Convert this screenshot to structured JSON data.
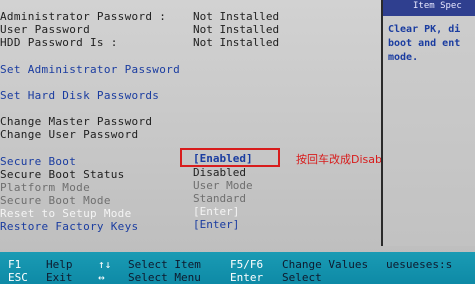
{
  "help_pane": {
    "title": "Item Spec",
    "lines": [
      "Clear PK, di",
      "boot and ent",
      "mode."
    ]
  },
  "passwords": [
    {
      "label": "Administrator Password :",
      "value": "Not Installed"
    },
    {
      "label": "User Password",
      "value": "Not Installed"
    },
    {
      "label": "HDD Password Is :",
      "value": "Not Installed"
    }
  ],
  "menu": {
    "set_admin_password": "Set Administrator Password",
    "set_hdd_passwords": "Set Hard Disk Passwords",
    "change_master_password": "Change Master Password",
    "change_user_password": "Change User Password"
  },
  "settings": [
    {
      "label": "Secure Boot",
      "value": "[Enabled]"
    },
    {
      "label": "Secure Boot Status",
      "value": "Disabled"
    },
    {
      "label": "Platform Mode",
      "value": "User Mode"
    },
    {
      "label": "Secure Boot Mode",
      "value": "Standard"
    },
    {
      "label": "Reset to Setup Mode",
      "value": "[Enter]"
    },
    {
      "label": "Restore Factory Keys",
      "value": "[Enter]"
    }
  ],
  "annotation": "按回车改成Disabled",
  "colors": {
    "highlight_box": "#d81c1c",
    "bios_blue": "#1a3ca0",
    "bottom_bar": "#1299b1"
  },
  "bottom_bar": {
    "row1": [
      {
        "key": "F1",
        "text": "Help"
      },
      {
        "key": "↑↓",
        "text": "Select Item"
      },
      {
        "key": "F5/F6",
        "text": "Change Values"
      },
      {
        "key": "",
        "text": "uesueses:s"
      }
    ],
    "row2": [
      {
        "key": "ESC",
        "text": "Exit"
      },
      {
        "key": "↔",
        "text": "Select Menu"
      },
      {
        "key": "Enter",
        "text": "Select"
      }
    ]
  }
}
